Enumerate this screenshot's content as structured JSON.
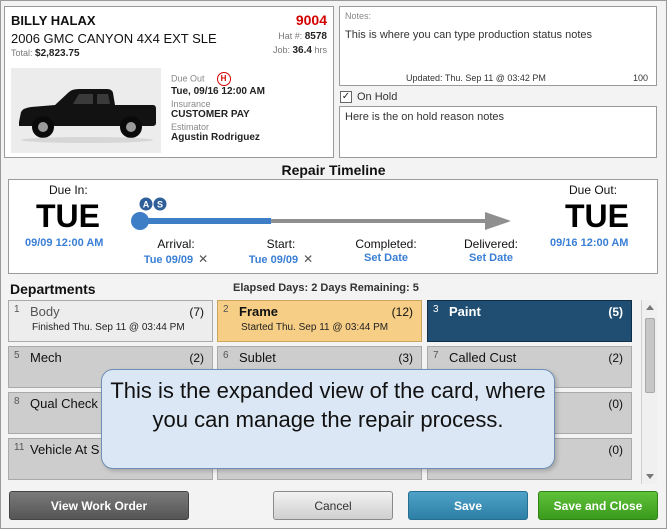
{
  "vehicle": {
    "customer": "BILLY HALAX",
    "description": "2006 GMC CANYON 4X4 EXT SLE",
    "total_label": "Total:",
    "total_value": "$2,823.75",
    "ro_number": "9004",
    "hat_label": "Hat #:",
    "hat_value": "8578",
    "job_label": "Job:",
    "job_value": "36.4",
    "job_unit": "hrs",
    "due_out_label": "Due Out",
    "badge": "H",
    "due_out_value": "Tue, 09/16 12:00 AM",
    "insurance_label": "Insurance",
    "insurance_value": "CUSTOMER PAY",
    "estimator_label": "Estimator",
    "estimator_value": "Agustin Rodriguez"
  },
  "notes": {
    "label": "Notes:",
    "text": "This is where you can type production status notes",
    "updated": "Updated: Thu. Sep 11 @ 03:42 PM",
    "count": "100"
  },
  "on_hold": {
    "checked": "✓",
    "label": "On Hold",
    "text": "Here is the on hold reason notes"
  },
  "timeline": {
    "title": "Repair Timeline",
    "due_in_label": "Due In:",
    "due_in_day": "TUE",
    "due_in_date": "09/09 12:00 AM",
    "due_out_label": "Due Out:",
    "due_out_day": "TUE",
    "due_out_date": "09/16 12:00 AM",
    "marker_a": "A",
    "marker_s": "S",
    "stages": [
      {
        "label": "Arrival:",
        "value": "Tue 09/09",
        "clear": "✕"
      },
      {
        "label": "Start:",
        "value": "Tue 09/09",
        "clear": "✕"
      },
      {
        "label": "Completed:",
        "value": "Set Date"
      },
      {
        "label": "Delivered:",
        "value": "Set Date"
      }
    ],
    "progress": 0.38,
    "colors": {
      "done": "#3e7ec6",
      "pending": "#8f8f8f"
    }
  },
  "departments": {
    "title": "Departments",
    "elapsed": "Elapsed Days:  2   Days Remaining: 5",
    "items": [
      {
        "num": "1",
        "name": "Body",
        "count": "(7)",
        "status": "Finished Thu. Sep 11 @ 03:44 PM"
      },
      {
        "num": "2",
        "name": "Frame",
        "count": "(12)",
        "status": "Started Thu. Sep 11 @ 03:44 PM"
      },
      {
        "num": "3",
        "name": "Paint",
        "count": "(5)"
      },
      {
        "num": "5",
        "name": "Mech",
        "count": "(2)"
      },
      {
        "num": "6",
        "name": "Sublet",
        "count": "(3)"
      },
      {
        "num": "7",
        "name": "Called Cust",
        "count": "(2)"
      },
      {
        "num": "8",
        "name": "Qual Check",
        "count": ""
      },
      {
        "num": "",
        "name": "",
        "count": ""
      },
      {
        "num": "",
        "name": "",
        "count": "(0)"
      },
      {
        "num": "11",
        "name": "Vehicle At S",
        "count": ""
      },
      {
        "num": "",
        "name": "",
        "count": ""
      },
      {
        "num": "",
        "name": "",
        "count": "(0)"
      }
    ]
  },
  "callout": {
    "text": "This is the expanded view of the card, where you can manage the repair process."
  },
  "buttons": {
    "view": "View Work Order",
    "cancel": "Cancel",
    "save": "Save",
    "save_close": "Save and Close"
  }
}
